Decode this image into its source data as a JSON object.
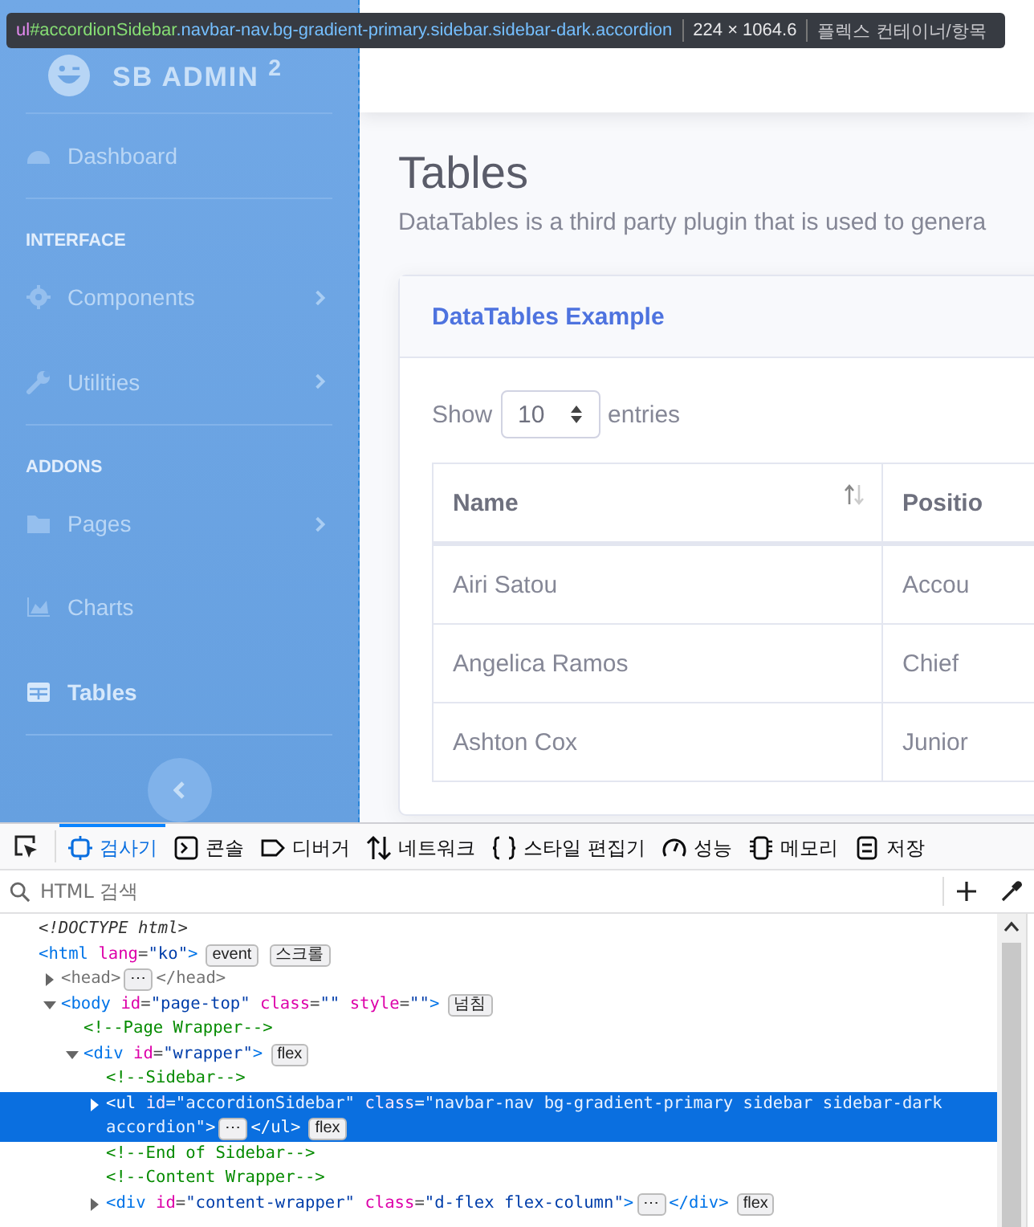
{
  "highlighter": {
    "selector_parts": [
      {
        "kind": "tag",
        "text": "ul"
      },
      {
        "kind": "id",
        "text": "#accordionSidebar"
      },
      {
        "kind": "class",
        "text": ".navbar-nav.bg-gradient-primary.sidebar.sidebar-dark.accordion"
      }
    ],
    "dimensions": "224 × 1064.6",
    "type": "플렉스 컨테이너/항목"
  },
  "sidebar": {
    "brand": "SB ADMIN $^{2}$",
    "sections": [
      {
        "items": [
          {
            "label": "Dashboard",
            "chevron": false,
            "selected": false
          }
        ]
      },
      {
        "heading": "INTERFACE",
        "items": [
          {
            "label": "Components",
            "chevron": true,
            "selected": false
          },
          {
            "label": "Utilities",
            "chevron": true,
            "selected": false
          }
        ]
      },
      {
        "heading": "ADDONS",
        "items": [
          {
            "label": "Pages",
            "chevron": true,
            "selected": false
          },
          {
            "label": "Charts",
            "chevron": false,
            "selected": false
          },
          {
            "label": "Tables",
            "chevron": false,
            "selected": true
          }
        ]
      }
    ]
  },
  "main": {
    "title": "Tables",
    "description": "DataTables is a third party plugin that is used to genera",
    "card": {
      "title": "DataTables Example",
      "show_label": "Show",
      "page_size": "10",
      "entries_label": "entries",
      "table": {
        "columns": [
          {
            "label": "Name",
            "sortable": true
          },
          {
            "label": "Positio",
            "sortable": false
          }
        ],
        "rows": [
          [
            "Airi Satou",
            "Accou"
          ],
          [
            "Angelica Ramos",
            "Chief"
          ],
          [
            "Ashton Cox",
            "Junior"
          ]
        ]
      }
    }
  },
  "devtools": {
    "tabs": [
      {
        "label": "검사기",
        "selected": true
      },
      {
        "label": "콘솔",
        "selected": false
      },
      {
        "label": "디버거",
        "selected": false
      },
      {
        "label": "네트워크",
        "selected": false
      },
      {
        "label": "스타일 편집기",
        "selected": false
      },
      {
        "label": "성능",
        "selected": false
      },
      {
        "label": "메모리",
        "selected": false
      },
      {
        "label": "저장",
        "selected": false
      }
    ],
    "search": {
      "placeholder": "HTML 검색"
    },
    "tree": [
      {
        "selected": false,
        "parts": [
          {
            "kind": "code",
            "tokens": [
              {
                "kind": "doctype",
                "s": "<!DOCTYPE html>"
              }
            ]
          }
        ]
      },
      {
        "selected": false,
        "parts": [
          {
            "kind": "code",
            "tokens": [
              {
                "kind": "tag",
                "s": "<html "
              },
              {
                "kind": "attr",
                "s": "lang"
              },
              {
                "kind": "punct",
                "s": "="
              },
              {
                "kind": "value",
                "s": "\"ko\""
              },
              {
                "kind": "tag",
                "s": ">"
              }
            ]
          },
          {
            "kind": "badge",
            "text": "event"
          },
          {
            "kind": "badge",
            "text": "스크롤"
          }
        ],
        "children": [
          {
            "selected": false,
            "expanded": false,
            "parts": [
              {
                "kind": "code",
                "tokens": [
                  {
                    "kind": "muted",
                    "s": "<head>"
                  }
                ]
              },
              {
                "kind": "more",
                "text": "⋯"
              },
              {
                "kind": "code",
                "tokens": [
                  {
                    "kind": "muted",
                    "s": "</head>"
                  }
                ]
              }
            ]
          },
          {
            "selected": false,
            "expanded": true,
            "parts": [
              {
                "kind": "code",
                "tokens": [
                  {
                    "kind": "tag",
                    "s": "<body "
                  },
                  {
                    "kind": "attr",
                    "s": "id"
                  },
                  {
                    "kind": "punct",
                    "s": "="
                  },
                  {
                    "kind": "value",
                    "s": "\"page-top\" "
                  },
                  {
                    "kind": "attr",
                    "s": "class"
                  },
                  {
                    "kind": "punct",
                    "s": "="
                  },
                  {
                    "kind": "value",
                    "s": "\"\" "
                  },
                  {
                    "kind": "attr",
                    "s": "style"
                  },
                  {
                    "kind": "punct",
                    "s": "="
                  },
                  {
                    "kind": "value",
                    "s": "\"\""
                  },
                  {
                    "kind": "tag",
                    "s": ">"
                  }
                ]
              },
              {
                "kind": "badge",
                "text": "넘침"
              }
            ],
            "children": [
              {
                "selected": false,
                "parts": [
                  {
                    "kind": "code",
                    "tokens": [
                      {
                        "kind": "comment",
                        "s": "<!--Page Wrapper-->"
                      }
                    ]
                  }
                ]
              },
              {
                "selected": false,
                "expanded": true,
                "parts": [
                  {
                    "kind": "code",
                    "tokens": [
                      {
                        "kind": "tag",
                        "s": "<div "
                      },
                      {
                        "kind": "attr",
                        "s": "id"
                      },
                      {
                        "kind": "punct",
                        "s": "="
                      },
                      {
                        "kind": "value",
                        "s": "\"wrapper\""
                      },
                      {
                        "kind": "tag",
                        "s": ">"
                      }
                    ]
                  },
                  {
                    "kind": "badge",
                    "text": "flex"
                  }
                ],
                "children": [
                  {
                    "selected": false,
                    "parts": [
                      {
                        "kind": "code",
                        "tokens": [
                          {
                            "kind": "comment",
                            "s": "<!--Sidebar-->"
                          }
                        ]
                      }
                    ]
                  },
                  {
                    "selected": true,
                    "expanded": false,
                    "parts": [
                      {
                        "kind": "code",
                        "tokens": [
                          {
                            "kind": "tag",
                            "s": "<ul "
                          },
                          {
                            "kind": "attr",
                            "s": "id"
                          },
                          {
                            "kind": "punct",
                            "s": "="
                          },
                          {
                            "kind": "value",
                            "s": "\"accordionSidebar\" "
                          },
                          {
                            "kind": "attr",
                            "s": "class"
                          },
                          {
                            "kind": "punct",
                            "s": "="
                          },
                          {
                            "kind": "value",
                            "s": "\"navbar-nav bg-gradient-primary sidebar sidebar-dark"
                          }
                        ]
                      },
                      {
                        "kind": "break"
                      },
                      {
                        "kind": "code",
                        "tokens": [
                          {
                            "kind": "value",
                            "s": "accordion\""
                          },
                          {
                            "kind": "tag",
                            "s": ">"
                          }
                        ]
                      },
                      {
                        "kind": "more",
                        "text": "⋯"
                      },
                      {
                        "kind": "code",
                        "tokens": [
                          {
                            "kind": "tag",
                            "s": "</ul>"
                          }
                        ]
                      },
                      {
                        "kind": "badge",
                        "text": "flex"
                      }
                    ]
                  },
                  {
                    "selected": false,
                    "parts": [
                      {
                        "kind": "code",
                        "tokens": [
                          {
                            "kind": "comment",
                            "s": "<!--End of Sidebar-->"
                          }
                        ]
                      }
                    ]
                  },
                  {
                    "selected": false,
                    "parts": [
                      {
                        "kind": "code",
                        "tokens": [
                          {
                            "kind": "comment",
                            "s": "<!--Content Wrapper-->"
                          }
                        ]
                      }
                    ]
                  },
                  {
                    "selected": false,
                    "expanded": false,
                    "parts": [
                      {
                        "kind": "code",
                        "tokens": [
                          {
                            "kind": "tag",
                            "s": "<div "
                          },
                          {
                            "kind": "attr",
                            "s": "id"
                          },
                          {
                            "kind": "punct",
                            "s": "="
                          },
                          {
                            "kind": "value",
                            "s": "\"content-wrapper\" "
                          },
                          {
                            "kind": "attr",
                            "s": "class"
                          },
                          {
                            "kind": "punct",
                            "s": "="
                          },
                          {
                            "kind": "value",
                            "s": "\"d-flex flex-column\""
                          },
                          {
                            "kind": "tag",
                            "s": ">"
                          }
                        ]
                      },
                      {
                        "kind": "more",
                        "text": "⋯"
                      },
                      {
                        "kind": "code",
                        "tokens": [
                          {
                            "kind": "tag",
                            "s": "</div>"
                          }
                        ]
                      },
                      {
                        "kind": "badge",
                        "text": "flex"
                      }
                    ]
                  }
                ]
              }
            ]
          }
        ]
      }
    ]
  }
}
